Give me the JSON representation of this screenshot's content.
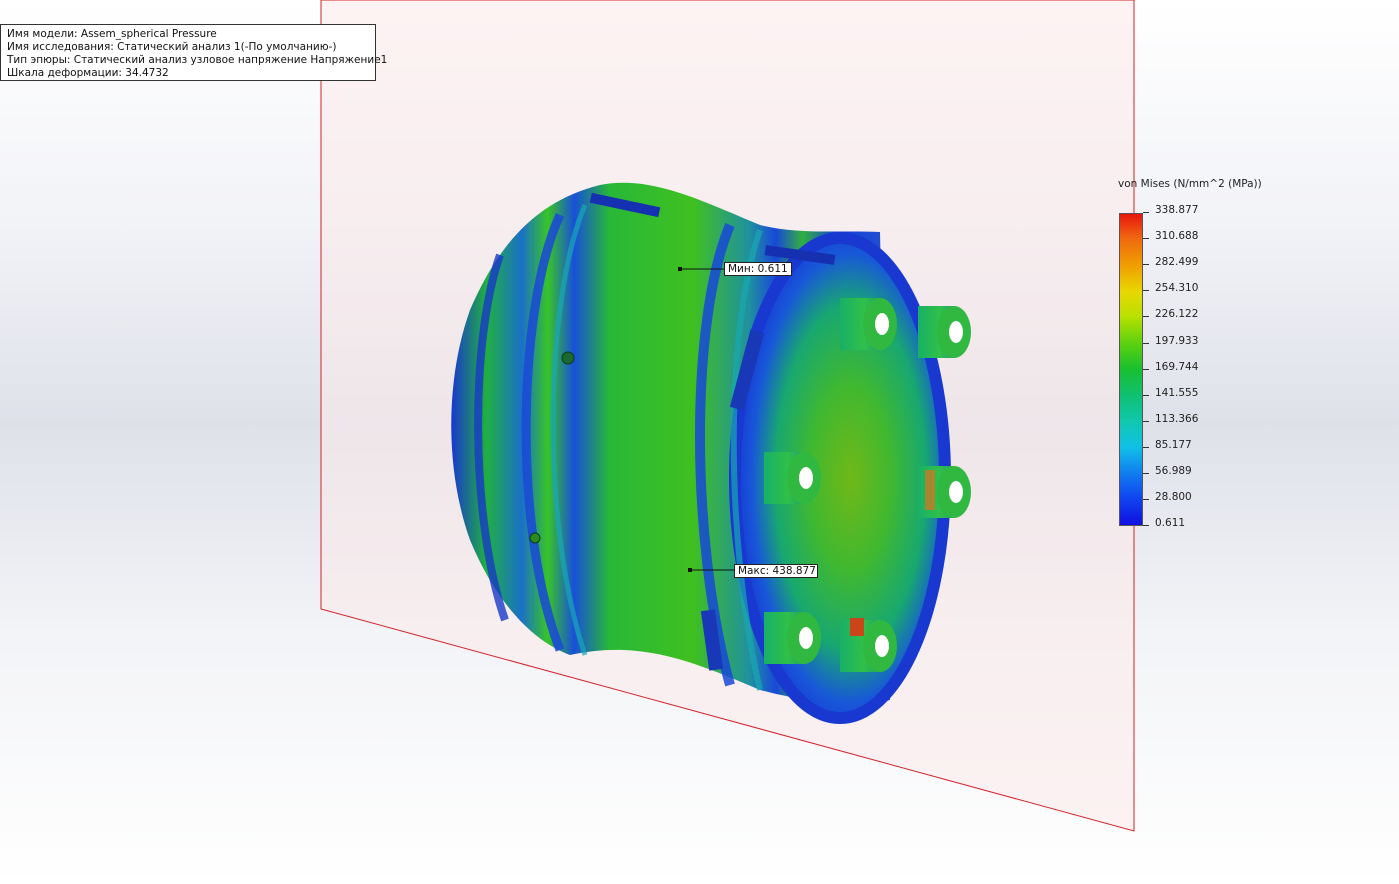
{
  "info": {
    "model_name": "Имя модели: Assem_spherical Pressure",
    "study_name": "Имя  исследования: Статический анализ 1(-По умолчанию-)",
    "plot_type": "Тип эпюры: Статический анализ узловое напряжение Напряжение1",
    "deformation_scale": "Шкала деформации: 34.4732"
  },
  "legend": {
    "title": "von Mises (N/mm^2 (MPa))",
    "values": [
      "338.877",
      "310.688",
      "282.499",
      "254.310",
      "226.122",
      "197.933",
      "169.744",
      "141.555",
      "113.366",
      "85.177",
      "56.989",
      "28.800",
      "0.611"
    ],
    "colors": [
      "#e8160f",
      "#f06a10",
      "#f0a000",
      "#e8d800",
      "#b8e000",
      "#58d010",
      "#18c030",
      "#10c070",
      "#10c8b0",
      "#10c0e8",
      "#1080f0",
      "#1040f0",
      "#1010e0"
    ]
  },
  "annotations": {
    "min_label": "Мин: 0.611",
    "max_label": "Макс: 438.877"
  },
  "colors": {
    "plane_edge": "#d2232a",
    "plane_fill": "#fbe4e6"
  }
}
